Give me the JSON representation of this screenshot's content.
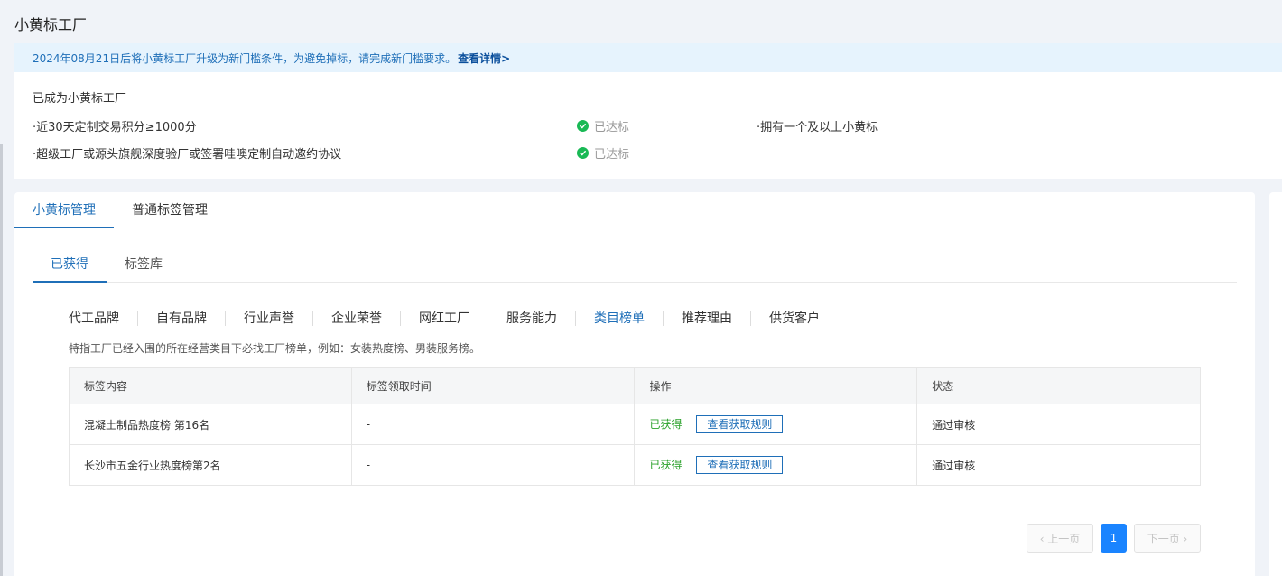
{
  "page": {
    "title": "小黄标工厂"
  },
  "notice": {
    "text": "2024年08月21日后将小黄标工厂升级为新门槛条件，为避免掉标，请完成新门槛要求。",
    "link": "查看详情>"
  },
  "status": {
    "title": "已成为小黄标工厂",
    "criteria": [
      {
        "label": "·近30天定制交易积分≥1000分",
        "state": "已达标"
      },
      {
        "label": "·超级工厂或源头旗舰深度验厂或签署哇噢定制自动邀约协议",
        "state": "已达标"
      },
      {
        "label": "·拥有一个及以上小黄标"
      }
    ]
  },
  "tabs": [
    {
      "label": "小黄标管理",
      "active": true
    },
    {
      "label": "普通标签管理",
      "active": false
    }
  ],
  "subtabs": [
    {
      "label": "已获得",
      "active": true
    },
    {
      "label": "标签库",
      "active": false
    }
  ],
  "categories": [
    {
      "label": "代工品牌"
    },
    {
      "label": "自有品牌"
    },
    {
      "label": "行业声誉"
    },
    {
      "label": "企业荣誉"
    },
    {
      "label": "网红工厂"
    },
    {
      "label": "服务能力"
    },
    {
      "label": "类目榜单",
      "active": true
    },
    {
      "label": "推荐理由"
    },
    {
      "label": "供货客户"
    }
  ],
  "description": "特指工厂已经入围的所在经营类目下必找工厂榜单，例如：女装热度榜、男装服务榜。",
  "table": {
    "headers": [
      "标签内容",
      "标签领取时间",
      "操作",
      "状态"
    ],
    "rows": [
      {
        "content": "混凝土制品热度榜 第16名",
        "time": "-",
        "op_status": "已获得",
        "op_button": "查看获取规则",
        "status": "通过审核"
      },
      {
        "content": "长沙市五金行业热度榜第2名",
        "time": "-",
        "op_status": "已获得",
        "op_button": "查看获取规则",
        "status": "通过审核"
      }
    ]
  },
  "pagination": {
    "prev": "‹ 上一页",
    "current": "1",
    "next": "下一页 ›"
  },
  "colors": {
    "accent": "#1f6fb8",
    "success": "#19b955",
    "got": "#2aa12a",
    "page_active": "#1a84ff"
  }
}
